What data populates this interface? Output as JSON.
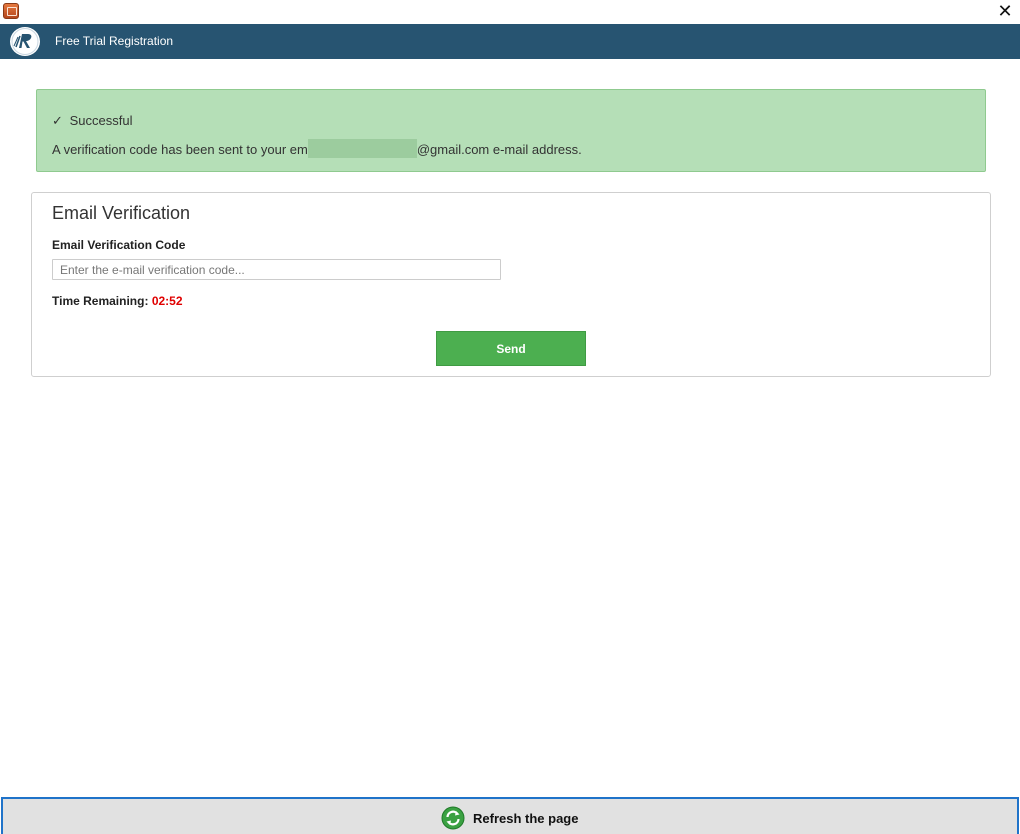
{
  "window": {
    "close_symbol": "✕"
  },
  "header": {
    "title": "Free Trial Registration",
    "logo_icon": "company-logo"
  },
  "alert": {
    "check_symbol": "✓",
    "status": "Successful",
    "message_prefix": "A verification code has been sent to your em",
    "message_suffix": "@gmail.com e-mail address.",
    "background": "#b5dfb7"
  },
  "verification": {
    "title": "Email Verification",
    "code_label": "Email Verification Code",
    "code_placeholder": "Enter the e-mail verification code...",
    "code_value": "",
    "timer_label": "Time Remaining:",
    "timer_value": "02:52",
    "timer_color": "#e00000",
    "send_label": "Send",
    "send_color": "#4caf50"
  },
  "footer": {
    "refresh_label": "Refresh the page",
    "refresh_icon": "refresh-icon"
  },
  "colors": {
    "header_bg": "#275471",
    "footer_border": "#1f73c9"
  }
}
